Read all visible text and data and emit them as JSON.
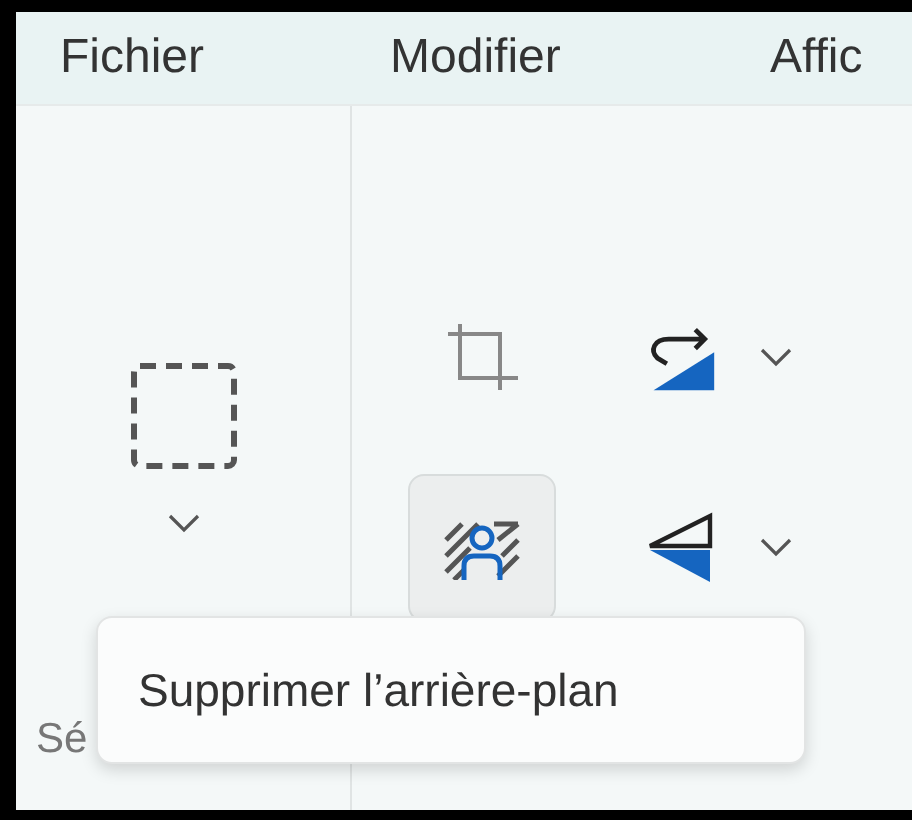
{
  "menu": [
    {
      "label": "Fichier"
    },
    {
      "label": "Modifier"
    },
    {
      "label": "Affic"
    }
  ],
  "ribbon": {
    "groups": [
      {
        "label": "Sé",
        "tools": [
          {
            "kind": "select",
            "selected": false,
            "dropdown": true
          }
        ]
      },
      {
        "tools": [
          {
            "kind": "crop",
            "selected": false,
            "dropdown": false
          },
          {
            "kind": "rotate",
            "selected": false,
            "dropdown": true
          },
          {
            "kind": "remove-background",
            "selected": true,
            "dropdown": false
          },
          {
            "kind": "flip",
            "selected": false,
            "dropdown": true
          }
        ]
      }
    ]
  },
  "tooltip": {
    "text": "Supprimer l’arrière-plan"
  }
}
